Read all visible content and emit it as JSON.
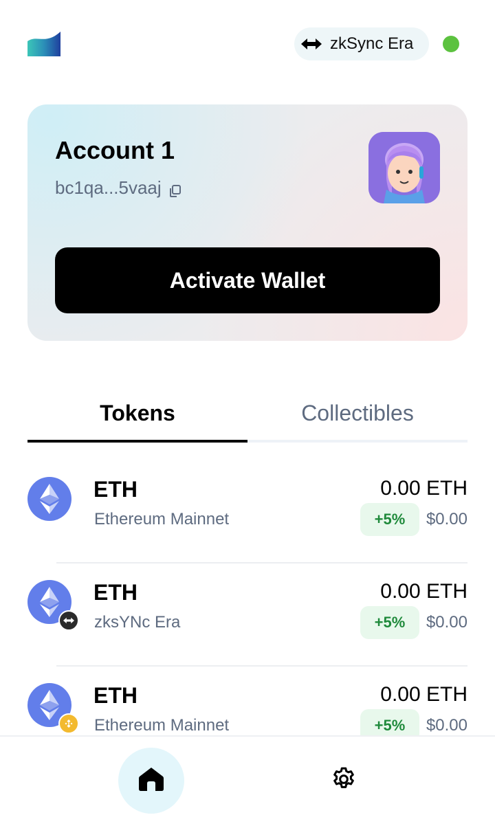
{
  "header": {
    "network_label": "zkSync Era",
    "status_color": "#5cc23f"
  },
  "account": {
    "name": "Account 1",
    "address": "bc1qa...5vaaj",
    "activate_label": "Activate Wallet"
  },
  "tabs": [
    {
      "label": "Tokens",
      "active": true
    },
    {
      "label": "Collectibles",
      "active": false
    }
  ],
  "tokens": [
    {
      "symbol": "ETH",
      "network": "Ethereum Mainnet",
      "amount": "0.00 ETH",
      "change": "+5%",
      "fiat": "$0.00",
      "badge": "none"
    },
    {
      "symbol": "ETH",
      "network": "zksYNc Era",
      "amount": "0.00 ETH",
      "change": "+5%",
      "fiat": "$0.00",
      "badge": "zksync-icon"
    },
    {
      "symbol": "ETH",
      "network": "Ethereum Mainnet",
      "amount": "0.00 ETH",
      "change": "+5%",
      "fiat": "$0.00",
      "badge": "bnb-icon"
    }
  ],
  "nav": {
    "home_icon": "home-icon",
    "settings_icon": "gear-icon"
  },
  "colors": {
    "accent": "#000000",
    "eth": "#627eea",
    "positive": "#1f8a3b",
    "muted": "#5e6b80"
  }
}
